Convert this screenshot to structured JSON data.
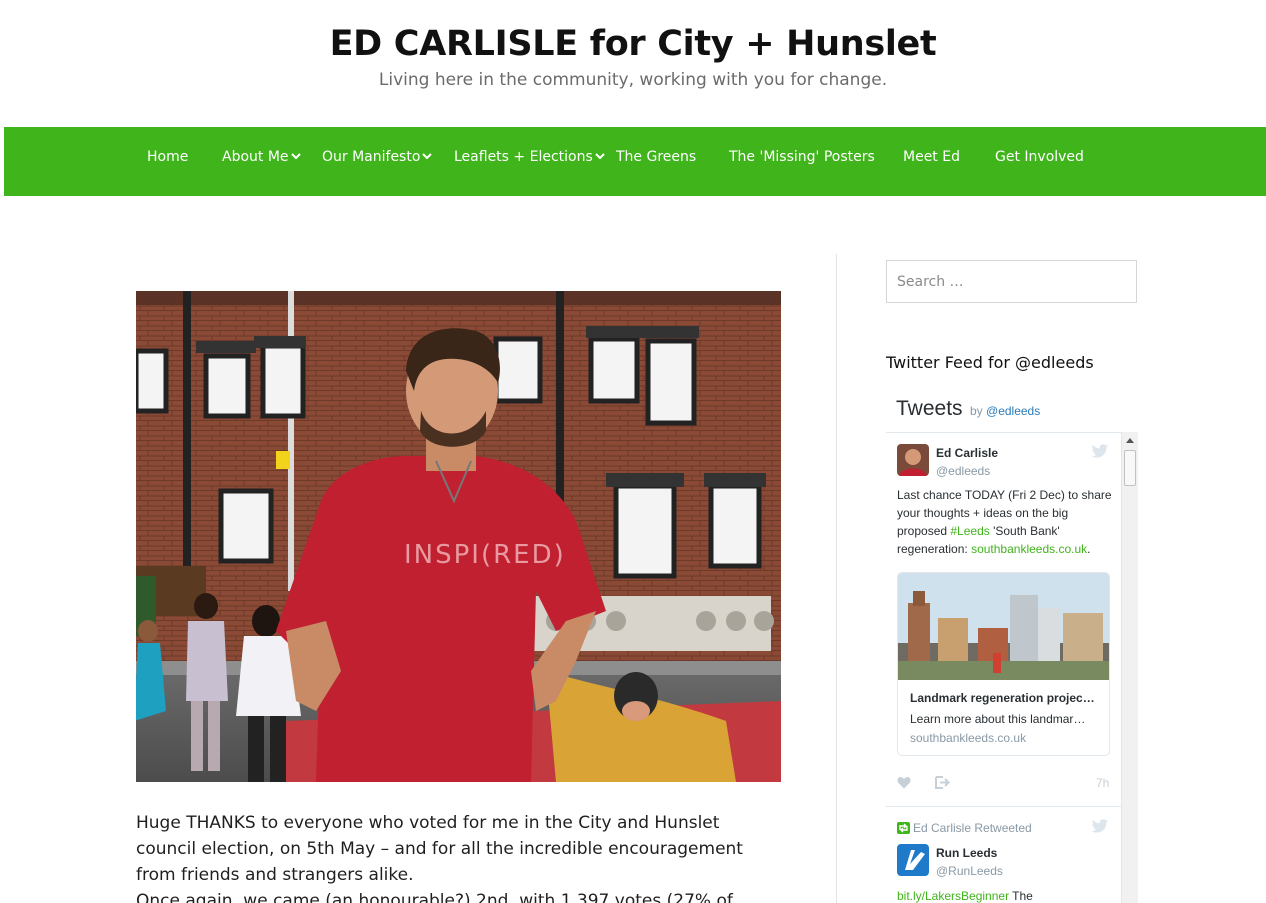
{
  "site": {
    "title": "ED CARLISLE for City + Hunslet",
    "tagline": "Living here in the community, working with you for change."
  },
  "nav": {
    "items": [
      {
        "label": "Home",
        "has_dropdown": false
      },
      {
        "label": "About Me",
        "has_dropdown": true
      },
      {
        "label": "Our Manifesto",
        "has_dropdown": true
      },
      {
        "label": "Leaflets + Elections",
        "has_dropdown": true
      },
      {
        "label": "The Greens",
        "has_dropdown": false
      },
      {
        "label": "The 'Missing' Posters",
        "has_dropdown": false
      },
      {
        "label": "Meet Ed",
        "has_dropdown": false
      },
      {
        "label": "Get Involved",
        "has_dropdown": false
      }
    ],
    "background_color": "#3fb41b"
  },
  "post": {
    "paragraph_1": "Huge THANKS to everyone who voted for me in the City and Hunslet council election, on 5th May – and for all the incredible encouragement from friends and strangers alike.",
    "paragraph_2": "Once again, we came (an honourable?) 2nd, with 1,397 votes (27% of"
  },
  "sidebar": {
    "search_placeholder": "Search …",
    "twitter_widget_title": "Twitter Feed for @edleeds"
  },
  "twitter": {
    "header_title": "Tweets",
    "header_by": "by",
    "header_handle": "@edleeds",
    "tweets": [
      {
        "name": "Ed Carlisle",
        "handle": "@edleeds",
        "text_before": "Last chance TODAY (Fri 2 Dec) to share your thoughts + ideas on the big proposed ",
        "hashtag": "#Leeds",
        "text_middle": " 'South Bank' regeneration: ",
        "link": "southbankleeds.co.uk",
        "text_after": ".",
        "card": {
          "title": "Landmark regeneration projec…",
          "description": "Learn more about this landmar…",
          "domain": "southbankleeds.co.uk"
        },
        "time": "7h"
      },
      {
        "retweeted_by": "Ed Carlisle Retweeted",
        "name": "Run Leeds",
        "handle": "@RunLeeds",
        "link": "bit.ly/LakersBeginner",
        "text_after": " The"
      }
    ],
    "link_color": "#3fb41b"
  }
}
